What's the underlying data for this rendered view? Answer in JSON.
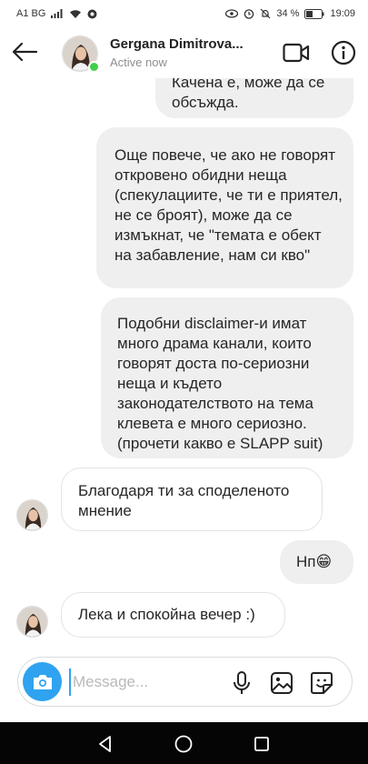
{
  "status_bar": {
    "carrier": "A1 BG",
    "battery": "34 %",
    "time": "19:09"
  },
  "header": {
    "name": "Gergana Dimitrova...",
    "status": "Active now"
  },
  "messages": [
    {
      "type": "sent",
      "text": "Качена е, може да се обсъжда."
    },
    {
      "type": "sent",
      "text": "Още повече, че ако не говорят откровено обидни неща (спекулациите, че ти е приятел, не се броят), може да се измъкнат, че \"темата е обект на забавление, нам си кво\""
    },
    {
      "type": "sent",
      "text": "Подобни disclaimer-и имат много драма канали, които говорят доста по-сериозни неща и където законодателството на тема клевета е много сериозно. (прочети какво е SLAPP suit)"
    },
    {
      "type": "received",
      "text": "Благодаря ти за споделеното мнение"
    },
    {
      "type": "sent",
      "text": "Нп😁"
    },
    {
      "type": "received",
      "text": "Лека и спокойна вечер :)"
    }
  ],
  "composer": {
    "placeholder": "Message..."
  },
  "colors": {
    "accent": "#2fa3f0",
    "online": "#3ecf4a",
    "sent_bubble": "#efefef"
  }
}
